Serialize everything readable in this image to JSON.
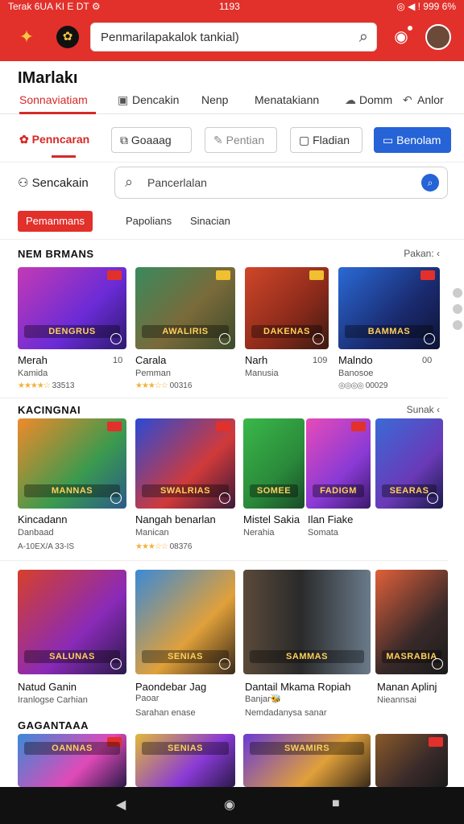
{
  "status": {
    "left": "Terak 6UA KI E DT  ⚙",
    "time": "1193",
    "right": "◎ ◀ ! 999 6%"
  },
  "search": {
    "text": "Penmarilapakalok tankial)"
  },
  "page": {
    "title": "IMarlakı"
  },
  "top_tabs": [
    {
      "label": "Sonnaviatiam",
      "icon": ""
    },
    {
      "label": "Dencakin",
      "icon": "▣"
    },
    {
      "label": "Nenp",
      "icon": ""
    },
    {
      "label": "Menatakiann",
      "icon": ""
    },
    {
      "label": "Domm",
      "icon": "☁"
    },
    {
      "label": "Anlor",
      "icon": "↶"
    }
  ],
  "actions": {
    "first": "Penncaran",
    "b1": "Goaaag",
    "b2": "Pentian",
    "b3": "Fladian",
    "b4": "Benolam"
  },
  "search_row": {
    "label": "Sencakain",
    "placeholder": "Pancerlalan"
  },
  "chips": [
    "Pemanmans",
    "Papolians",
    "Sinacian"
  ],
  "sections": [
    {
      "title": "NEM BRMANS",
      "more": "Pakan: ‹",
      "cards": [
        {
          "name": "Merah",
          "num": "10",
          "sub": "Kamida",
          "rating": "33513",
          "band": "DENGRUS"
        },
        {
          "name": "Carala",
          "num": "",
          "sub": "Pemman",
          "rating": "00316",
          "band": "AWALIRIS"
        },
        {
          "name": "Narh",
          "num": "109",
          "sub": "Manusia",
          "rating": "",
          "band": "DAKENAS"
        },
        {
          "name": "Malndo",
          "num": "00",
          "sub": "Banosoe",
          "rating": "00029",
          "band": "BAMMAS"
        }
      ]
    },
    {
      "title": "KACINGNAI",
      "more": "Sunak ‹",
      "cards": [
        {
          "name": "Kincadann",
          "sub": "Danbaad",
          "rating": "A-10EX/A 33-IS",
          "band": "MANNAS"
        },
        {
          "name": "Nangah benarlan",
          "sub": "Manican",
          "rating": "08376",
          "band": "SWALRIAS"
        },
        {
          "name": "Mistel Sakia",
          "sub": "Nerahia",
          "rating": "",
          "band": "SOMEE"
        },
        {
          "name": "Ilan Fiake",
          "sub": "Somata",
          "rating": "",
          "band": "FADIGM"
        },
        {
          "name": "",
          "sub": "",
          "rating": "",
          "band": "SEARAS"
        }
      ]
    },
    {
      "title": "",
      "more": "",
      "cards": [
        {
          "name": "Natud Ganin",
          "sub": "Iranlogse  Carhian",
          "rating": "",
          "band": "SALUNAS"
        },
        {
          "name": "Paondebar Jag",
          "sub": "Paoar",
          "sub2": "Sarahan enase",
          "band": "SENIAS"
        },
        {
          "name": "Dantail Mkama Ropiah",
          "sub": "Banjar🐝",
          "sub2": "Nemdadanysa sanar",
          "band": "SAMMAS"
        },
        {
          "name": "Manan Aplinj",
          "sub": "Nieannsai",
          "band": "MASRABIA"
        }
      ]
    },
    {
      "title": "GAGANTAAA",
      "more": "",
      "cards": [
        {
          "band": "OANNAS"
        },
        {
          "band": "SENIAS"
        },
        {
          "band": "SWAMIRS"
        },
        {
          "band": ""
        }
      ]
    }
  ],
  "colors": {
    "brand_red": "#e2302b",
    "accent_blue": "#2563d6",
    "star": "#f3b13a"
  }
}
